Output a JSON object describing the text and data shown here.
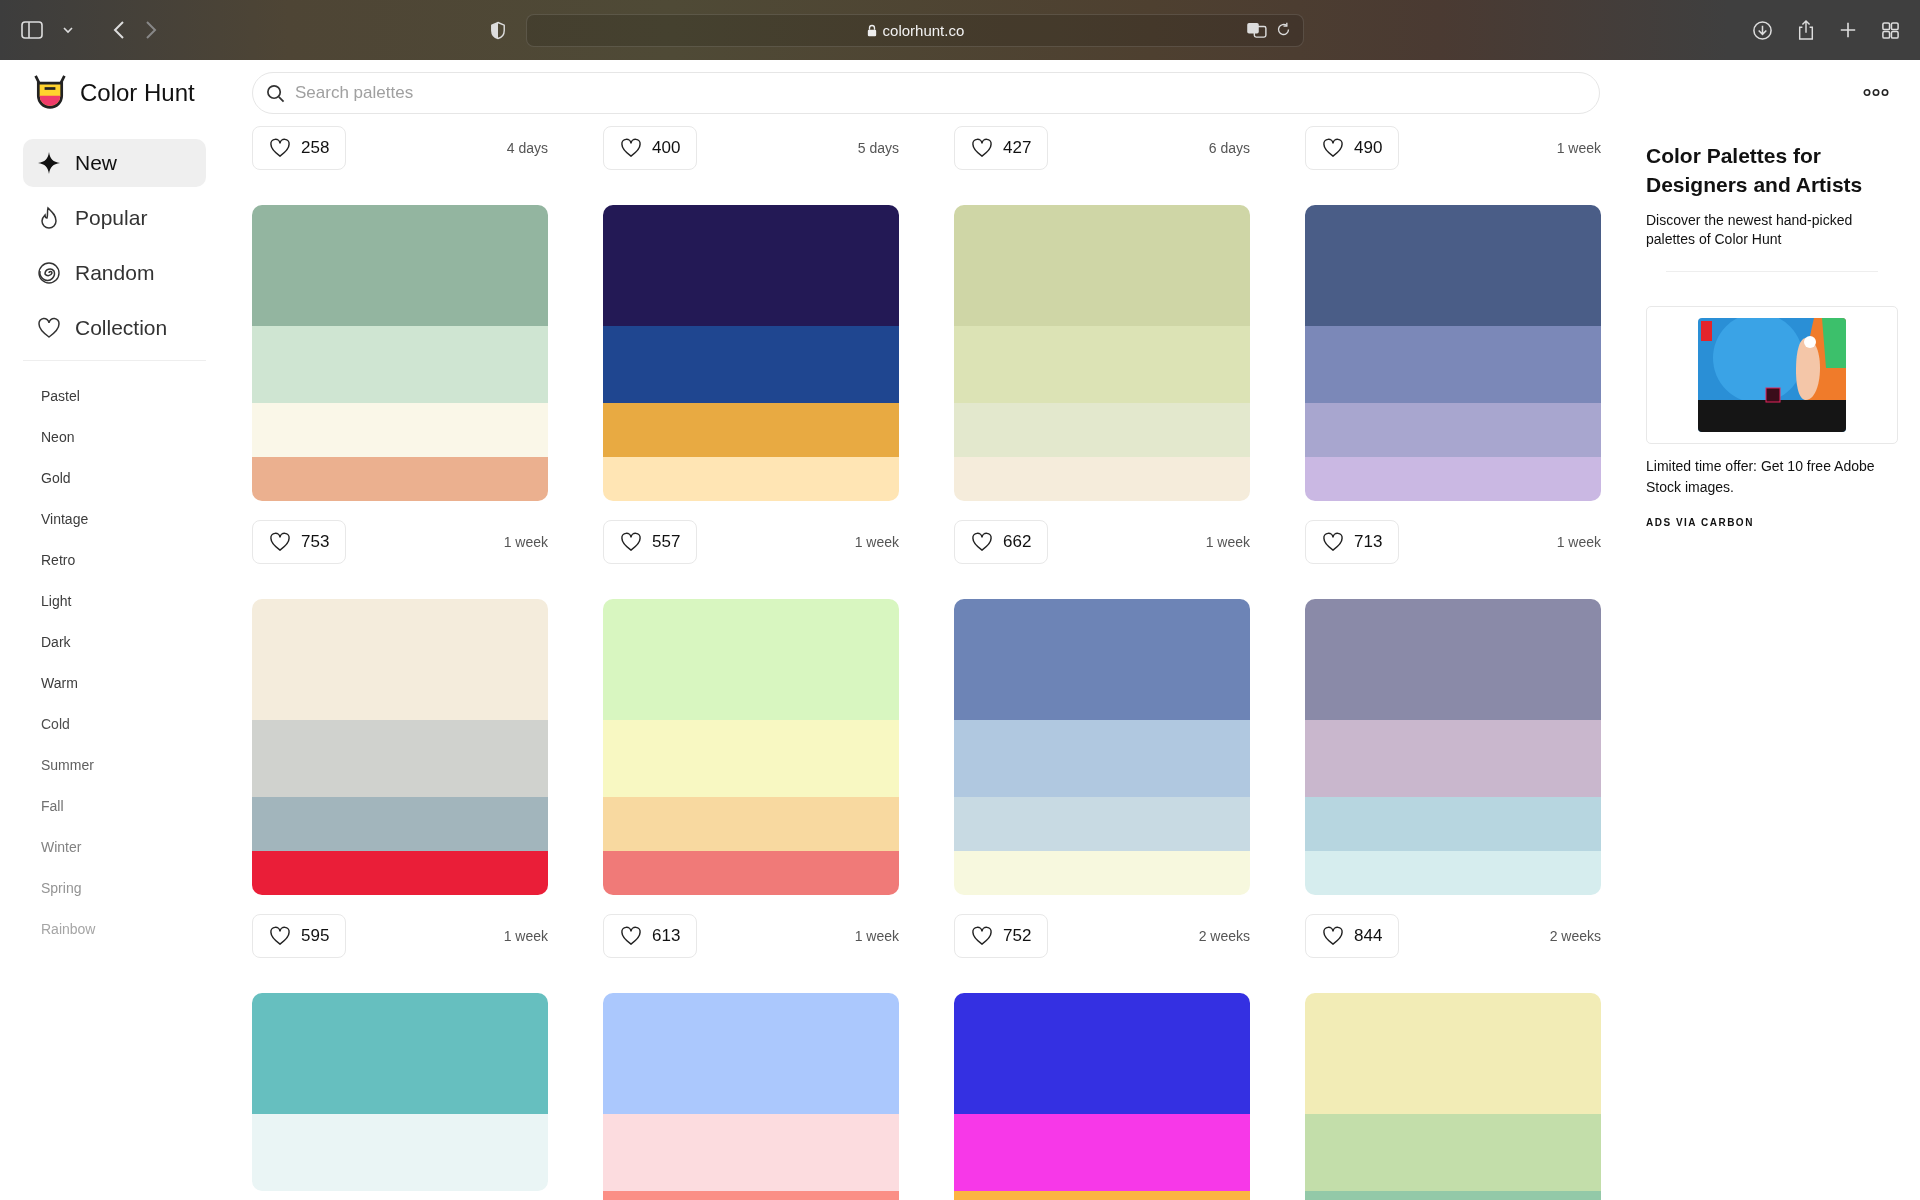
{
  "browser": {
    "address": "colorhunt.co"
  },
  "header": {
    "logo_text": "Color Hunt",
    "search": {
      "placeholder": "Search palettes"
    }
  },
  "sidebar": {
    "nav": [
      {
        "label": "New",
        "selected": true
      },
      {
        "label": "Popular",
        "selected": false
      },
      {
        "label": "Random",
        "selected": false
      },
      {
        "label": "Collection",
        "selected": false
      }
    ],
    "tags": [
      "Pastel",
      "Neon",
      "Gold",
      "Vintage",
      "Retro",
      "Light",
      "Dark",
      "Warm",
      "Cold",
      "Summer",
      "Fall",
      "Winter",
      "Spring",
      "Rainbow"
    ]
  },
  "palettes": [
    {
      "likes": "258",
      "time": "4 days"
    },
    {
      "likes": "400",
      "time": "5 days"
    },
    {
      "likes": "427",
      "time": "6 days"
    },
    {
      "likes": "490",
      "time": "1 week"
    },
    {
      "stripes": [
        {
          "color": "#93b5a0"
        },
        {
          "color": "#cfe5d2"
        },
        {
          "color": "#faf7e8"
        },
        {
          "color": "#ebb08f"
        }
      ],
      "likes": "753",
      "time": "1 week"
    },
    {
      "stripes": [
        {
          "color": "#231955"
        },
        {
          "color": "#1f4690"
        },
        {
          "color": "#e8aa42"
        },
        {
          "color": "#ffe5b4"
        }
      ],
      "likes": "557",
      "time": "1 week"
    },
    {
      "stripes": [
        {
          "color": "#cfd6a6"
        },
        {
          "color": "#dce3b5"
        },
        {
          "color": "#e3e8cd"
        },
        {
          "color": "#f5ecdb"
        }
      ],
      "likes": "662",
      "time": "1 week"
    },
    {
      "stripes": [
        {
          "color": "#4a5d87"
        },
        {
          "color": "#7b88b8"
        },
        {
          "color": "#a8a6cf"
        },
        {
          "color": "#cab8e3"
        }
      ],
      "likes": "713",
      "time": "1 week"
    },
    {
      "stripes": [
        {
          "color": "#f4ecdc"
        },
        {
          "color": "#d0d2ce"
        },
        {
          "color": "#a2b5bc"
        },
        {
          "color": "#ea1e38"
        }
      ],
      "likes": "595",
      "time": "1 week"
    },
    {
      "stripes": [
        {
          "color": "#d8f6c0"
        },
        {
          "color": "#f8f8c2"
        },
        {
          "color": "#f8d9a0"
        },
        {
          "color": "#f07a78"
        }
      ],
      "likes": "613",
      "time": "1 week"
    },
    {
      "stripes": [
        {
          "color": "#6d84b6"
        },
        {
          "color": "#b0c8e0"
        },
        {
          "color": "#c8dae3"
        },
        {
          "color": "#f7f8de"
        }
      ],
      "likes": "752",
      "time": "2 weeks"
    },
    {
      "stripes": [
        {
          "color": "#8a8aa8"
        },
        {
          "color": "#c9b7cd"
        },
        {
          "color": "#b7d6e0"
        },
        {
          "color": "#d6edee"
        }
      ],
      "likes": "844",
      "time": "2 weeks"
    },
    {
      "stripes": [
        {
          "color": "#66bfbf"
        },
        {
          "color": "#eaf5f5"
        }
      ]
    },
    {
      "stripes": [
        {
          "color": "#abc8fd"
        },
        {
          "color": "#fcdcdf"
        },
        {
          "color": "#fb8f86"
        }
      ]
    },
    {
      "stripes": [
        {
          "color": "#3430e2"
        },
        {
          "color": "#f738e8"
        },
        {
          "color": "#fcb441"
        }
      ]
    },
    {
      "stripes": [
        {
          "color": "#f2ecb6"
        },
        {
          "color": "#c3deaa"
        },
        {
          "color": "#93c9a8"
        }
      ]
    }
  ],
  "aside": {
    "title": "Color Palettes for Designers and Artists",
    "description": "Discover the newest hand-picked palettes of Color Hunt",
    "ad": {
      "text": "Limited time offer: Get 10 free Adobe Stock images.",
      "via": "ADS VIA CARBON"
    }
  }
}
